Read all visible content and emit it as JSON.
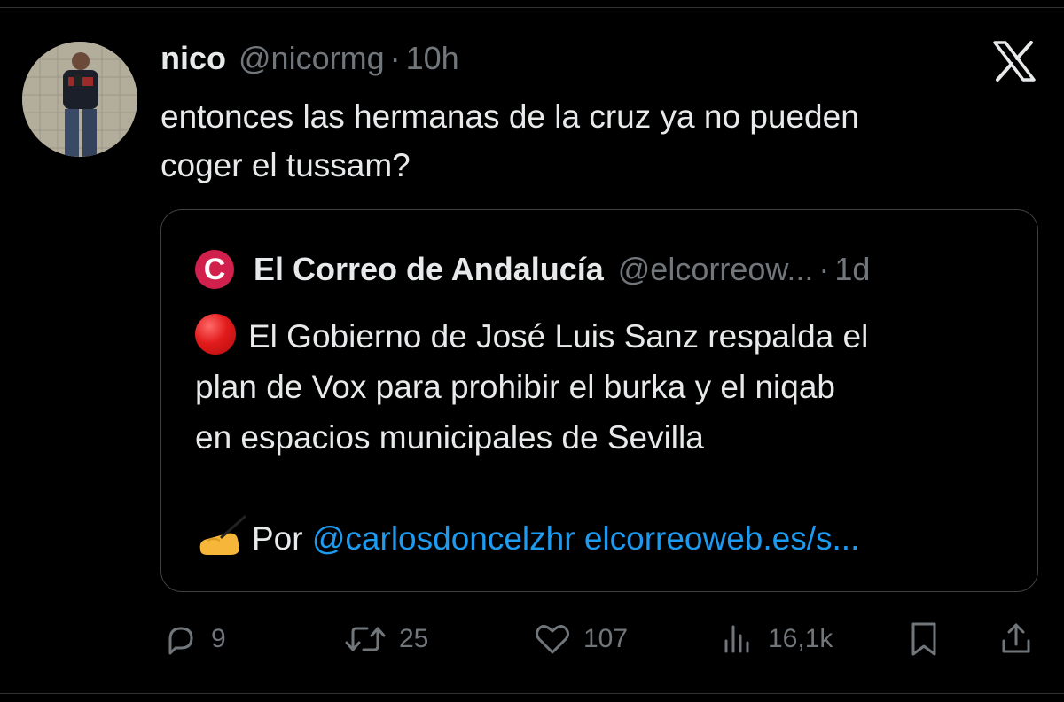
{
  "tweet": {
    "author_name": "nico",
    "author_handle": "@nicormg",
    "separator": "·",
    "time": "10h",
    "text": "entonces las hermanas de la cruz ya no pueden\ncoger el tussam?"
  },
  "quote": {
    "logo_letter": "C",
    "name": "El Correo de Andalucía",
    "handle": "@elcorreow...",
    "separator": "·",
    "time": "1d",
    "line1": "El Gobierno de José Luis Sanz respalda el",
    "line2": "plan de Vox para prohibir el burka y el niqab",
    "line3": "en espacios municipales de Sevilla",
    "by_label": "Por",
    "mention": "@carlosdoncelzhr",
    "link": "elcorreoweb.es/s..."
  },
  "actions": {
    "replies": "9",
    "retweets": "25",
    "likes": "107",
    "views": "16,1k"
  },
  "colors": {
    "background": "#000000",
    "text": "#e7e9ea",
    "secondary": "#71767b",
    "link": "#1d9bf0",
    "quote_logo": "#d1204b"
  },
  "icons": [
    "x-logo-icon",
    "red-circle-emoji-icon",
    "writing-hand-emoji-icon",
    "reply-icon",
    "retweet-icon",
    "like-icon",
    "views-icon",
    "bookmark-icon",
    "share-icon"
  ]
}
